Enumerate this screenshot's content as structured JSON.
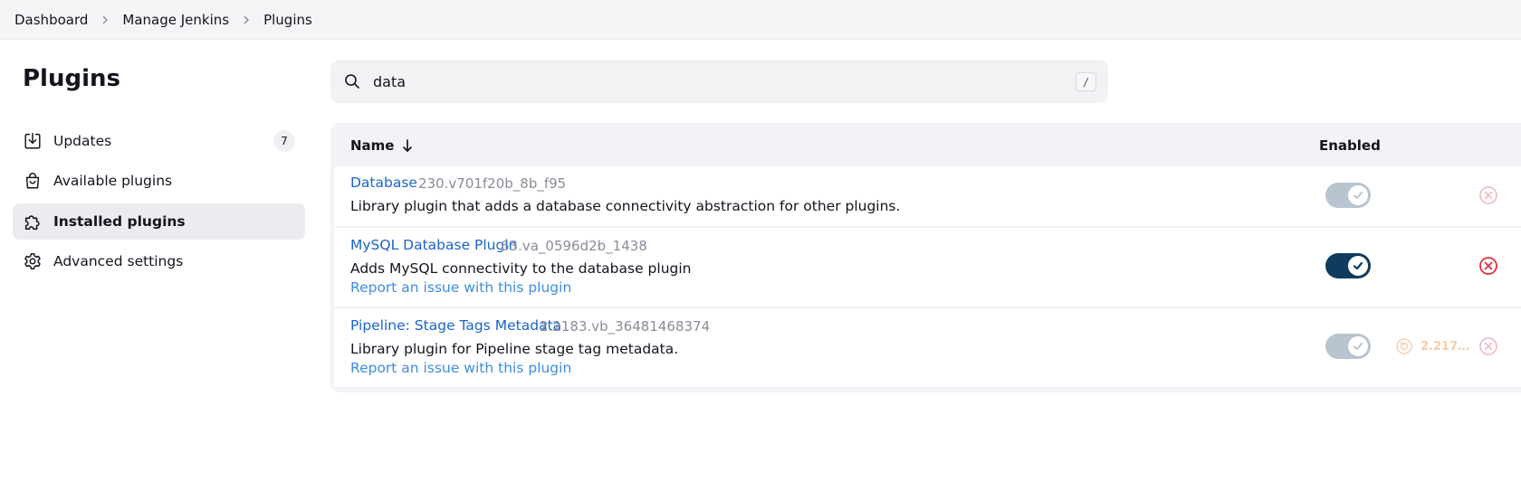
{
  "breadcrumb": {
    "items": [
      "Dashboard",
      "Manage Jenkins",
      "Plugins"
    ]
  },
  "sidebar": {
    "title": "Plugins",
    "items": [
      {
        "label": "Updates",
        "badge": "7",
        "icon": "download-icon"
      },
      {
        "label": "Available plugins",
        "icon": "shopping-bag-icon"
      },
      {
        "label": "Installed plugins",
        "icon": "puzzle-icon",
        "active": true
      },
      {
        "label": "Advanced settings",
        "icon": "gear-icon"
      }
    ]
  },
  "search": {
    "value": "data",
    "shortcut": "/"
  },
  "table": {
    "columns": {
      "name": "Name",
      "enabled": "Enabled"
    },
    "rows": [
      {
        "name": "Database",
        "version": "230.v701f20b_8b_f95",
        "description": "Library plugin that adds a database connectivity abstraction for other plugins.",
        "enabled": true,
        "toggle_state": "disabled-style"
      },
      {
        "name": "MySQL Database Plugin",
        "version": "63.va_0596d2b_1438",
        "description": "Adds MySQL connectivity to the database plugin",
        "report": "Report an issue with this plugin",
        "enabled": true,
        "toggle_state": "active"
      },
      {
        "name": "Pipeline: Stage Tags Metadata",
        "version": "2.2183.vb_36481468374",
        "description": "Library plugin for Pipeline stage tag metadata.",
        "report": "Report an issue with this plugin",
        "downgrade": "2.217…",
        "enabled": true,
        "toggle_state": "disabled-style"
      }
    ]
  },
  "colors": {
    "link": "#1b64c8",
    "toggle_on": "#0f3c5e",
    "toggle_dim": "#b8c4cf",
    "uninstall": "#e0303f"
  }
}
